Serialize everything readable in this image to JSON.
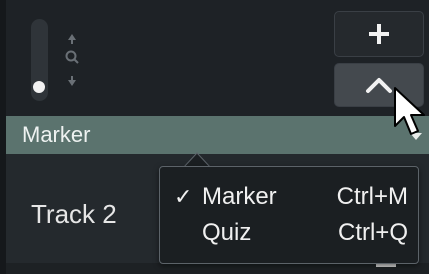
{
  "timeline": {
    "zoom_slider": {
      "level": 0.0
    },
    "buttons": {
      "add_icon": "plus-icon",
      "collapse_icon": "chevron-up-icon"
    },
    "marker_bar": {
      "label": "Marker",
      "color": "#5b736e"
    },
    "track": {
      "label": "Track 2"
    },
    "dropdown": {
      "items": [
        {
          "checked": true,
          "check_mark": "✓",
          "label": "Marker",
          "shortcut": "Ctrl+M"
        },
        {
          "checked": false,
          "check_mark": "",
          "label": "Quiz",
          "shortcut": "Ctrl+Q"
        }
      ]
    }
  }
}
